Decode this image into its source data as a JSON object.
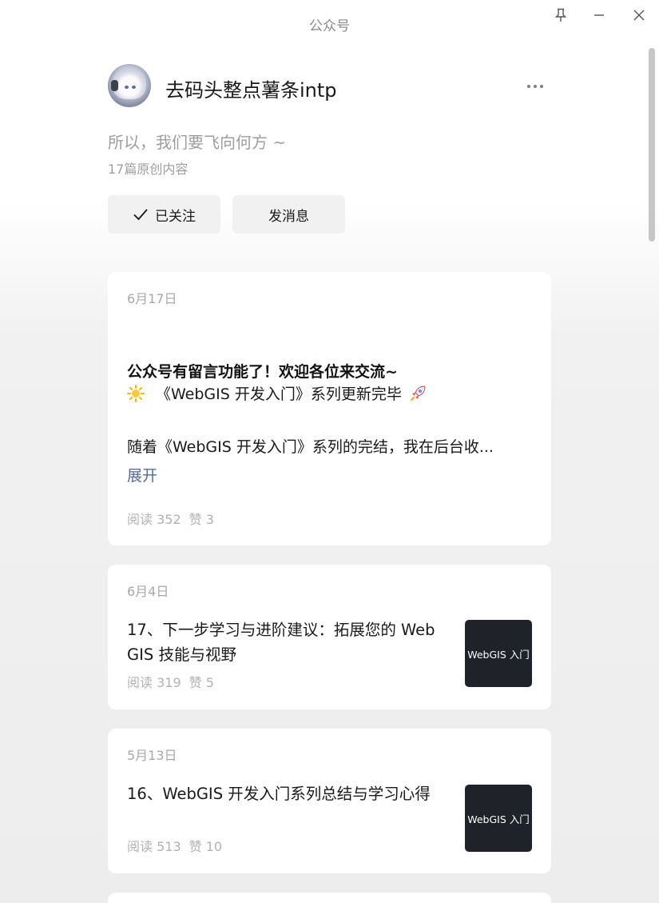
{
  "window": {
    "title": "公众号",
    "pin_icon": "pin-icon",
    "minimize_icon": "minimize-icon",
    "close_icon": "close-icon"
  },
  "profile": {
    "name": "去码头整点薯条intp",
    "bio": "所以，我们要飞向何方 ~",
    "original_count": "17篇原创内容",
    "follow_label": "已关注",
    "message_label": "发消息",
    "more_icon": "more-icon"
  },
  "pinned_post": {
    "date": "6月17日",
    "headline": "公众号有留言功能了！欢迎各位来交流~",
    "line2": "《WebGIS 开发入门》系列更新完毕",
    "line3": "随着《WebGIS 开发入门》系列的完结，我在后台收...",
    "expand_label": "展开",
    "reads": "阅读 352",
    "likes": "赞 3"
  },
  "articles": [
    {
      "date": "6月4日",
      "title": "17、下一步学习与进阶建议：拓展您的 WebGIS 技能与视野",
      "reads": "阅读 319",
      "likes": "赞 5",
      "thumb_text": "WebGIS 入门"
    },
    {
      "date": "5月13日",
      "title": "16、WebGIS 开发入门系列总结与学习心得",
      "reads": "阅读 513",
      "likes": "赞 10",
      "thumb_text": "WebGIS 入门"
    }
  ]
}
